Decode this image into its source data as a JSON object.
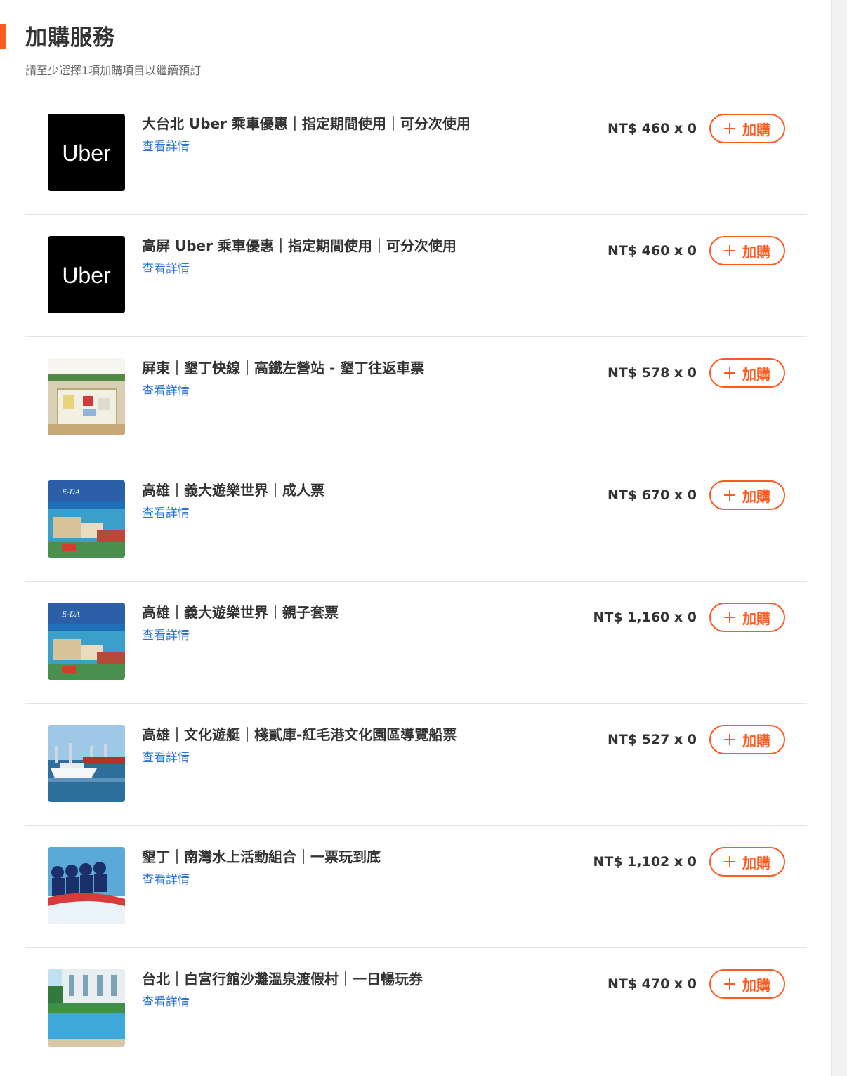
{
  "header": {
    "title": "加購服務",
    "subtitle": "請至少選擇1項加購項目以繼續預訂"
  },
  "colors": {
    "accent": "#ff5a1f",
    "link": "#2a74d8"
  },
  "items": [
    {
      "name": "大台北 Uber 乘車優惠｜指定期間使用｜可分次使用",
      "details_label": "查看詳情",
      "price": "NT$ 460 x 0",
      "button_label": "加購",
      "thumb": "uber",
      "thumb_text": "Uber"
    },
    {
      "name": "高屏 Uber 乘車優惠｜指定期間使用｜可分次使用",
      "details_label": "查看詳情",
      "price": "NT$ 460 x 0",
      "button_label": "加購",
      "thumb": "uber",
      "thumb_text": "Uber"
    },
    {
      "name": "屏東｜墾丁快線｜高鐵左營站 - 墾丁往返車票",
      "details_label": "查看詳情",
      "price": "NT$ 578 x 0",
      "button_label": "加購",
      "thumb": "bus-station-photo"
    },
    {
      "name": "高雄｜義大遊樂世界｜成人票",
      "details_label": "查看詳情",
      "price": "NT$ 670 x 0",
      "button_label": "加購",
      "thumb": "theme-park-photo"
    },
    {
      "name": "高雄｜義大遊樂世界｜親子套票",
      "details_label": "查看詳情",
      "price": "NT$ 1,160 x 0",
      "button_label": "加購",
      "thumb": "theme-park-photo"
    },
    {
      "name": "高雄｜文化遊艇｜棧貳庫-紅毛港文化園區導覽船票",
      "details_label": "查看詳情",
      "price": "NT$ 527 x 0",
      "button_label": "加購",
      "thumb": "harbor-boat-photo"
    },
    {
      "name": "墾丁｜南灣水上活動組合｜一票玩到底",
      "details_label": "查看詳情",
      "price": "NT$ 1,102 x 0",
      "button_label": "加購",
      "thumb": "banana-boat-photo"
    },
    {
      "name": "台北｜白宮行館沙灘溫泉渡假村｜一日暢玩券",
      "details_label": "查看詳情",
      "price": "NT$ 470 x 0",
      "button_label": "加購",
      "thumb": "resort-pool-photo"
    }
  ]
}
